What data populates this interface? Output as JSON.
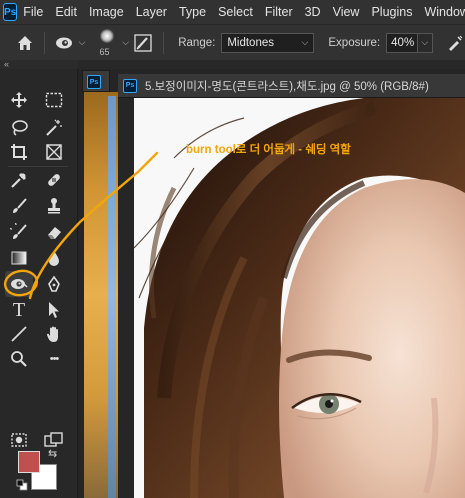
{
  "app": {
    "logo_text": "Ps",
    "menu": [
      "File",
      "Edit",
      "Image",
      "Layer",
      "Type",
      "Select",
      "Filter",
      "3D",
      "View",
      "Plugins",
      "Window"
    ]
  },
  "options_bar": {
    "brush_size": "65",
    "range_label": "Range:",
    "range_value": "Midtones",
    "exposure_label": "Exposure:",
    "exposure_value": "40%"
  },
  "toolbar": {
    "collapse_glyph": "«",
    "tools": [
      {
        "name": "move-tool",
        "icon": "move-icon"
      },
      {
        "name": "rect-marquee-tool",
        "icon": "marquee-icon"
      },
      {
        "name": "lasso-tool",
        "icon": "lasso-icon"
      },
      {
        "name": "magic-wand-tool",
        "icon": "wand-icon"
      },
      {
        "name": "crop-tool",
        "icon": "crop-icon"
      },
      {
        "name": "frame-tool",
        "icon": "frame-icon"
      },
      {
        "name": "eyedropper-tool",
        "icon": "eyedropper-icon"
      },
      {
        "name": "healing-brush-tool",
        "icon": "bandage-icon"
      },
      {
        "name": "brush-tool",
        "icon": "brush-icon"
      },
      {
        "name": "clone-stamp-tool",
        "icon": "stamp-icon"
      },
      {
        "name": "history-brush-tool",
        "icon": "history-brush-icon"
      },
      {
        "name": "eraser-tool",
        "icon": "eraser-icon"
      },
      {
        "name": "gradient-tool",
        "icon": "gradient-icon"
      },
      {
        "name": "blur-tool",
        "icon": "drop-icon"
      },
      {
        "name": "burn-tool",
        "icon": "burn-icon"
      },
      {
        "name": "pen-tool",
        "icon": "pen-icon"
      },
      {
        "name": "type-tool",
        "icon": "type-icon"
      },
      {
        "name": "path-selection-tool",
        "icon": "arrow-icon"
      },
      {
        "name": "line-tool",
        "icon": "line-icon"
      },
      {
        "name": "hand-tool",
        "icon": "hand-icon"
      },
      {
        "name": "zoom-tool",
        "icon": "zoom-icon"
      },
      {
        "name": "more-tools",
        "icon": "ellipsis-icon"
      }
    ],
    "type_glyph": "T",
    "more_glyph": "•••",
    "swap_glyph": "⇆",
    "colors": {
      "foreground": "#c0504f",
      "background": "#ffffff"
    },
    "active_tool": "burn-tool"
  },
  "document": {
    "title": "5.보정이미지-명도(콘트라스트),채도.jpg @ 50% (RGB/8#)",
    "back_tab_logo": "Ps",
    "tab_logo": "Ps"
  },
  "annotation": {
    "text": "burn tool로 더 어둡게 - 쉐딩 역할",
    "color": "#f2a60a"
  }
}
